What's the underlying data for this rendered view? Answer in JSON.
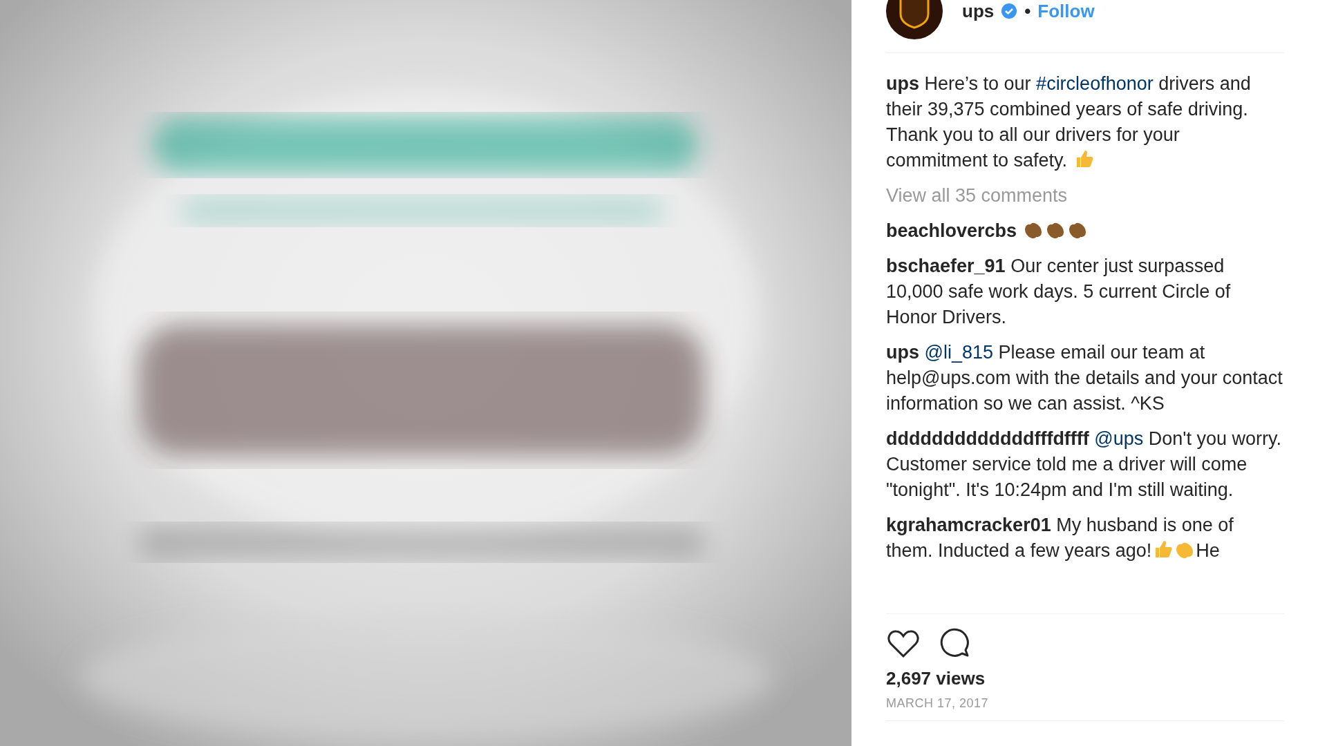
{
  "post": {
    "author": "ups",
    "verified": true,
    "separator": "•",
    "follow": "Follow"
  },
  "caption": {
    "user": "ups",
    "segments": [
      {
        "kind": "text",
        "text": "Here’s to our "
      },
      {
        "kind": "link",
        "text": "#circleofhonor"
      },
      {
        "kind": "text",
        "text": " drivers and their 39,375 combined years of safe driving. Thank you to all our drivers for your commitment to safety. "
      },
      {
        "kind": "thumbs",
        "color": "#f5b935"
      }
    ]
  },
  "view_all": "View all 35 comments",
  "comments": [
    {
      "user": "beachlovercbs",
      "segments": [
        {
          "kind": "clap",
          "color": "#8b5a2b"
        },
        {
          "kind": "clap",
          "color": "#8b5a2b"
        },
        {
          "kind": "clap",
          "color": "#8b5a2b"
        }
      ]
    },
    {
      "user": "bschaefer_91",
      "segments": [
        {
          "kind": "text",
          "text": "Our center just surpassed 10,000 safe work days. 5 current Circle of Honor Drivers."
        }
      ]
    },
    {
      "user": "ups",
      "segments": [
        {
          "kind": "link",
          "text": "@li_815"
        },
        {
          "kind": "text",
          "text": " Please email our team at help@ups.com with the details and your contact information so we can assist. ^KS"
        }
      ]
    },
    {
      "user": "dddddddddddddfffdffff",
      "segments": [
        {
          "kind": "link",
          "text": "@ups"
        },
        {
          "kind": "text",
          "text": " Don't you worry. Customer service told me a driver will come \"tonight\". It's 10:24pm and I'm still waiting."
        }
      ]
    },
    {
      "user": "kgrahamcracker01",
      "segments": [
        {
          "kind": "text",
          "text": "My husband is one of them. Inducted a few years ago!"
        },
        {
          "kind": "thumbs",
          "color": "#f5b935"
        },
        {
          "kind": "clap",
          "color": "#f5b935"
        },
        {
          "kind": "text",
          "text": "He"
        }
      ]
    }
  ],
  "views": "2,697 views",
  "date": "MARCH 17, 2017"
}
